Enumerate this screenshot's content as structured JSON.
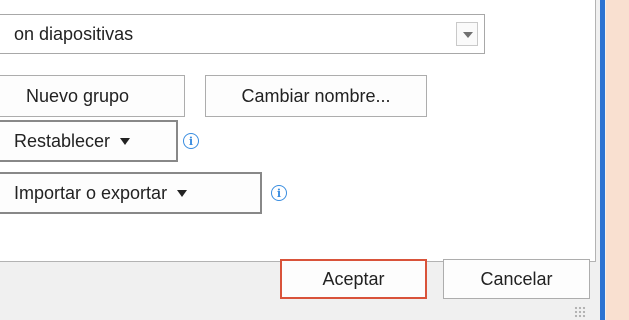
{
  "list": {
    "partial_item": "on diapositivas"
  },
  "buttons": {
    "new_group": "Nuevo grupo",
    "rename": "Cambiar nombre...",
    "reset": "Restablecer",
    "import_export": "Importar o exportar",
    "accept": "Aceptar",
    "cancel": "Cancelar"
  },
  "icons": {
    "info": "i"
  }
}
